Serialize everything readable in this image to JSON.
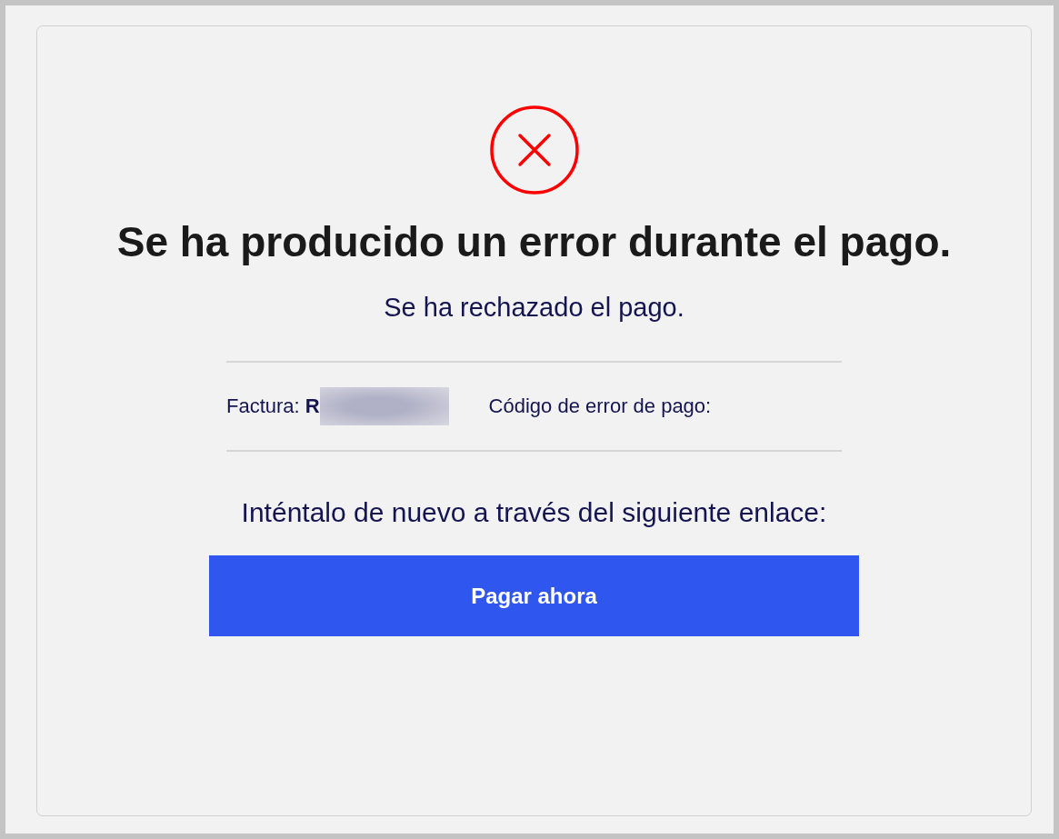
{
  "title": "Se ha producido un error durante el pago.",
  "message": "Se ha rechazado el pago.",
  "details": {
    "invoice_label": "Factura:",
    "invoice_value": "R",
    "invoice_redacted": true,
    "error_code_label": "Código de error de pago:"
  },
  "retry_text": "Inténtalo de nuevo a través del siguiente enlace:",
  "button": "Pagar ahora"
}
